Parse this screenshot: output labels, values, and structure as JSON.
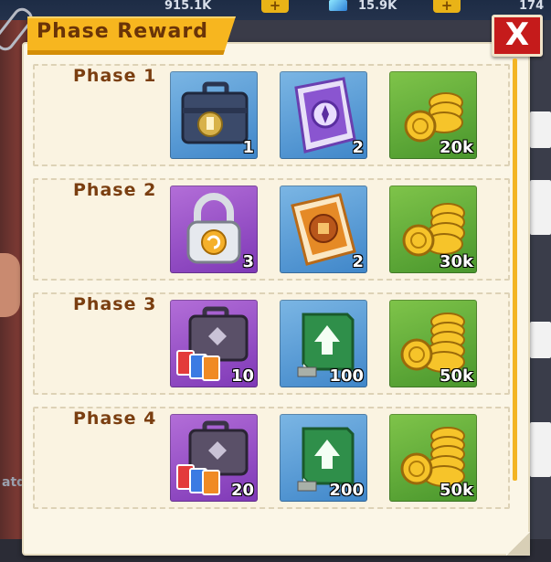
{
  "hud": {
    "currency1": "915.1K",
    "currency2": "15.9K",
    "currency3": "174",
    "plus": "+",
    "bottom_text": "atdo"
  },
  "dialog": {
    "title": "Phase Reward",
    "close_label": "X"
  },
  "phases": [
    {
      "label": "Phase 1",
      "rewards": [
        {
          "icon": "briefcase-icon",
          "qty": "1",
          "bg": "blue"
        },
        {
          "icon": "purple-ticket-icon",
          "qty": "2",
          "bg": "blue"
        },
        {
          "icon": "gold-coins-icon",
          "qty": "20k",
          "bg": "green"
        }
      ]
    },
    {
      "label": "Phase 2",
      "rewards": [
        {
          "icon": "padlock-icon",
          "qty": "3",
          "bg": "purple"
        },
        {
          "icon": "orange-ticket-icon",
          "qty": "2",
          "bg": "blue"
        },
        {
          "icon": "gold-coins-icon",
          "qty": "30k",
          "bg": "green"
        }
      ]
    },
    {
      "label": "Phase 3",
      "rewards": [
        {
          "icon": "chest-cards-icon",
          "qty": "10",
          "bg": "purple"
        },
        {
          "icon": "green-book-icon",
          "qty": "100",
          "bg": "blue"
        },
        {
          "icon": "gold-coins-icon",
          "qty": "50k",
          "bg": "green"
        }
      ]
    },
    {
      "label": "Phase 4",
      "rewards": [
        {
          "icon": "chest-cards-icon",
          "qty": "20",
          "bg": "purple"
        },
        {
          "icon": "green-book-icon",
          "qty": "200",
          "bg": "blue"
        },
        {
          "icon": "gold-coins-icon",
          "qty": "50k",
          "bg": "green"
        }
      ]
    }
  ],
  "colors": {
    "accent": "#f7b61f",
    "close": "#c51b1b",
    "label": "#7a3e10",
    "panel": "#fbf6e7"
  }
}
